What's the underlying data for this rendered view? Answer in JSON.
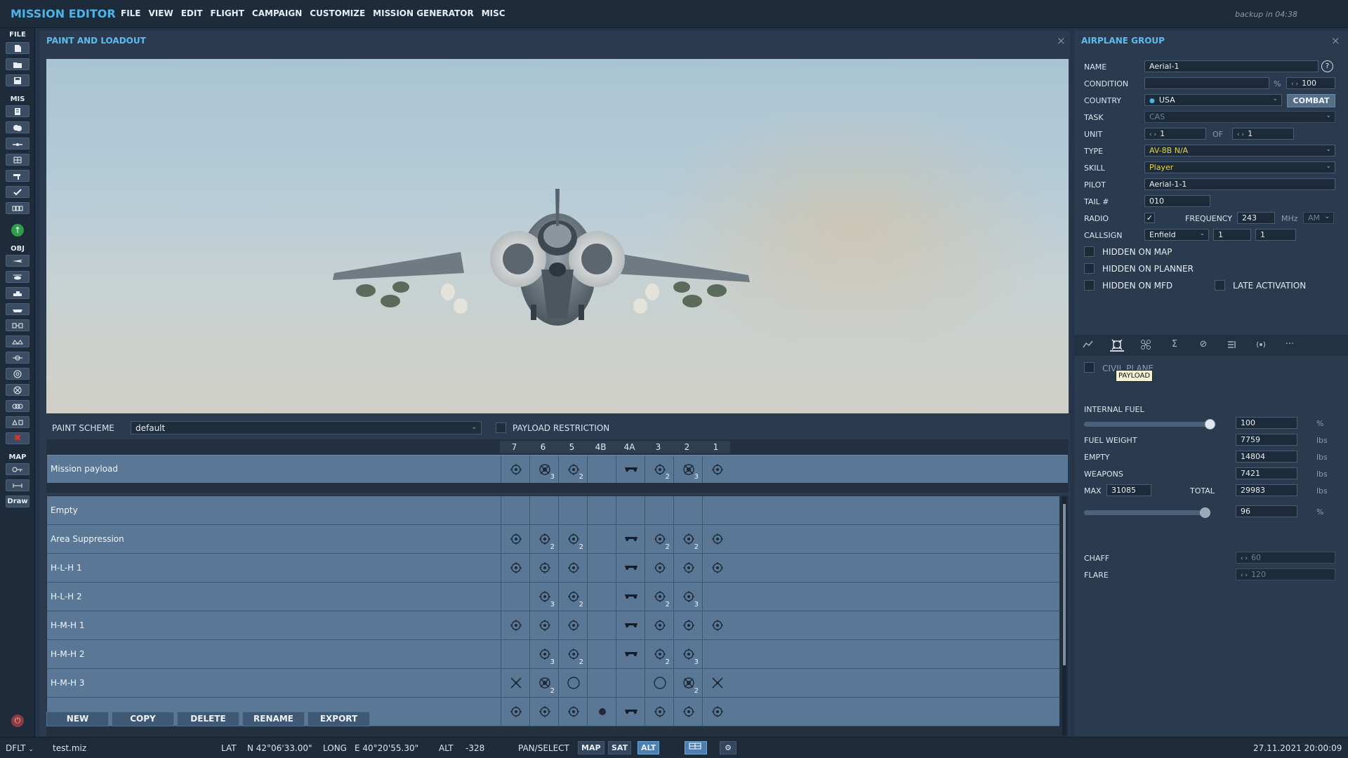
{
  "app": {
    "title": "MISSION EDITOR",
    "backup": "backup in 04:38"
  },
  "menu": [
    "FILE",
    "VIEW",
    "EDIT",
    "FLIGHT",
    "CAMPAIGN",
    "CUSTOMIZE",
    "MISSION GENERATOR",
    "MISC"
  ],
  "toolbar": {
    "file_label": "FILE",
    "mis_label": "MIS",
    "obj_label": "OBJ",
    "map_label": "MAP",
    "draw_label": "Draw"
  },
  "paint": {
    "title": "PAINT AND LOADOUT",
    "scheme_label": "PAINT SCHEME",
    "scheme_value": "default",
    "restriction_label": "PAYLOAD RESTRICTION",
    "pylons": [
      "7",
      "6",
      "5",
      "4B",
      "4A",
      "3",
      "2",
      "1"
    ],
    "mission_payload": {
      "label": "Mission payload",
      "cells": [
        [
          "bomb",
          ""
        ],
        [
          "cluster",
          "3"
        ],
        [
          "bomb",
          "2"
        ],
        [
          "none",
          ""
        ],
        [
          "pod",
          ""
        ],
        [
          "bomb",
          "2"
        ],
        [
          "cluster",
          "3"
        ],
        [
          "bomb",
          ""
        ]
      ]
    },
    "loadouts": [
      {
        "label": "Empty",
        "cells": [
          [
            "none",
            ""
          ],
          [
            "none",
            ""
          ],
          [
            "none",
            ""
          ],
          [
            "none",
            ""
          ],
          [
            "none",
            ""
          ],
          [
            "none",
            ""
          ],
          [
            "none",
            ""
          ],
          [
            "none",
            ""
          ]
        ]
      },
      {
        "label": "Area Suppression",
        "cells": [
          [
            "bomb",
            ""
          ],
          [
            "bomb",
            "2"
          ],
          [
            "bomb",
            "2"
          ],
          [
            "none",
            ""
          ],
          [
            "pod",
            ""
          ],
          [
            "bomb",
            "2"
          ],
          [
            "bomb",
            "2"
          ],
          [
            "bomb",
            ""
          ]
        ]
      },
      {
        "label": "H-L-H 1",
        "cells": [
          [
            "bomb",
            ""
          ],
          [
            "bomb",
            ""
          ],
          [
            "bomb",
            ""
          ],
          [
            "none",
            ""
          ],
          [
            "pod",
            ""
          ],
          [
            "bomb",
            ""
          ],
          [
            "bomb",
            ""
          ],
          [
            "bomb",
            ""
          ]
        ]
      },
      {
        "label": "H-L-H 2",
        "cells": [
          [
            "none",
            ""
          ],
          [
            "bomb",
            "3"
          ],
          [
            "bomb",
            "2"
          ],
          [
            "none",
            ""
          ],
          [
            "pod",
            ""
          ],
          [
            "bomb",
            "2"
          ],
          [
            "bomb",
            "3"
          ],
          [
            "none",
            ""
          ]
        ]
      },
      {
        "label": "H-M-H 1",
        "cells": [
          [
            "bomb",
            ""
          ],
          [
            "bomb",
            ""
          ],
          [
            "bomb",
            ""
          ],
          [
            "none",
            ""
          ],
          [
            "pod",
            ""
          ],
          [
            "bomb",
            ""
          ],
          [
            "bomb",
            ""
          ],
          [
            "bomb",
            ""
          ]
        ]
      },
      {
        "label": "H-M-H 2",
        "cells": [
          [
            "none",
            ""
          ],
          [
            "bomb",
            "3"
          ],
          [
            "bomb",
            "2"
          ],
          [
            "none",
            ""
          ],
          [
            "pod",
            ""
          ],
          [
            "bomb",
            "2"
          ],
          [
            "bomb",
            "3"
          ],
          [
            "none",
            ""
          ]
        ]
      },
      {
        "label": "H-M-H 3",
        "cells": [
          [
            "missile",
            ""
          ],
          [
            "cluster",
            "2"
          ],
          [
            "tank",
            ""
          ],
          [
            "none",
            ""
          ],
          [
            "none",
            ""
          ],
          [
            "tank",
            ""
          ],
          [
            "cluster",
            "2"
          ],
          [
            "missile",
            ""
          ]
        ]
      },
      {
        "label": "",
        "cells": [
          [
            "bomb",
            ""
          ],
          [
            "bomb",
            ""
          ],
          [
            "bomb",
            ""
          ],
          [
            "dot",
            ""
          ],
          [
            "pod",
            ""
          ],
          [
            "bomb",
            ""
          ],
          [
            "bomb",
            ""
          ],
          [
            "bomb",
            ""
          ]
        ]
      }
    ],
    "buttons": [
      "NEW",
      "COPY",
      "DELETE",
      "RENAME",
      "EXPORT"
    ]
  },
  "group": {
    "title": "AIRPLANE GROUP",
    "name_label": "NAME",
    "name": "Aerial-1",
    "help": "?",
    "condition_label": "CONDITION",
    "condition_unit": "%",
    "condition_value": "100",
    "country_label": "COUNTRY",
    "country": "USA",
    "combat": "COMBAT",
    "task_label": "TASK",
    "task": "CAS",
    "unit_label": "UNIT",
    "unit": "1",
    "of_label": "OF",
    "of": "1",
    "type_label": "TYPE",
    "type": "AV-8B N/A",
    "skill_label": "SKILL",
    "skill": "Player",
    "pilot_label": "PILOT",
    "pilot": "Aerial-1-1",
    "tail_label": "TAIL #",
    "tail": "010",
    "radio_label": "RADIO",
    "frequency_label": "FREQUENCY",
    "frequency": "243",
    "mhz": "MHz",
    "modulation": "AM",
    "callsign_label": "CALLSIGN",
    "callsign": "Enfield",
    "callsign_num1": "1",
    "callsign_num2": "1",
    "hidden_map": "HIDDEN ON MAP",
    "hidden_planner": "HIDDEN ON PLANNER",
    "hidden_mfd": "HIDDEN ON MFD",
    "late_activation": "LATE ACTIVATION",
    "civil_plane": "CIVIL PLANE",
    "tooltip": "PAYLOAD",
    "internal_fuel_label": "INTERNAL FUEL",
    "internal_fuel": "100",
    "internal_fuel_fraction": 1.0,
    "pct": "%",
    "lbs": "lbs",
    "fuel_weight_label": "FUEL WEIGHT",
    "fuel_weight": "7759",
    "empty_label": "EMPTY",
    "empty": "14804",
    "weapons_label": "WEAPONS",
    "weapons": "7421",
    "max_label": "MAX",
    "max": "31085",
    "total_label": "TOTAL",
    "total": "29983",
    "total_pct": "96",
    "total_fraction": 0.96,
    "chaff_label": "CHAFF",
    "chaff": "60",
    "flare_label": "FLARE",
    "flare": "120"
  },
  "status": {
    "profile": "DFLT",
    "file": "test.miz",
    "lat_label": "LAT",
    "lat": "N 42°06'33.00\"",
    "long_label": "LONG",
    "long": "E 40°20'55.30\"",
    "alt_label": "ALT",
    "alt": "-328",
    "mode": "PAN/SELECT",
    "map": "MAP",
    "sat": "SAT",
    "alt_btn": "ALT",
    "datetime": "27.11.2021 20:00:09"
  },
  "colors": {
    "accent": "#4fb3e8",
    "panel": "#2a3b4f",
    "row": "#5a7796",
    "yellow_text": "#e8d53a"
  }
}
